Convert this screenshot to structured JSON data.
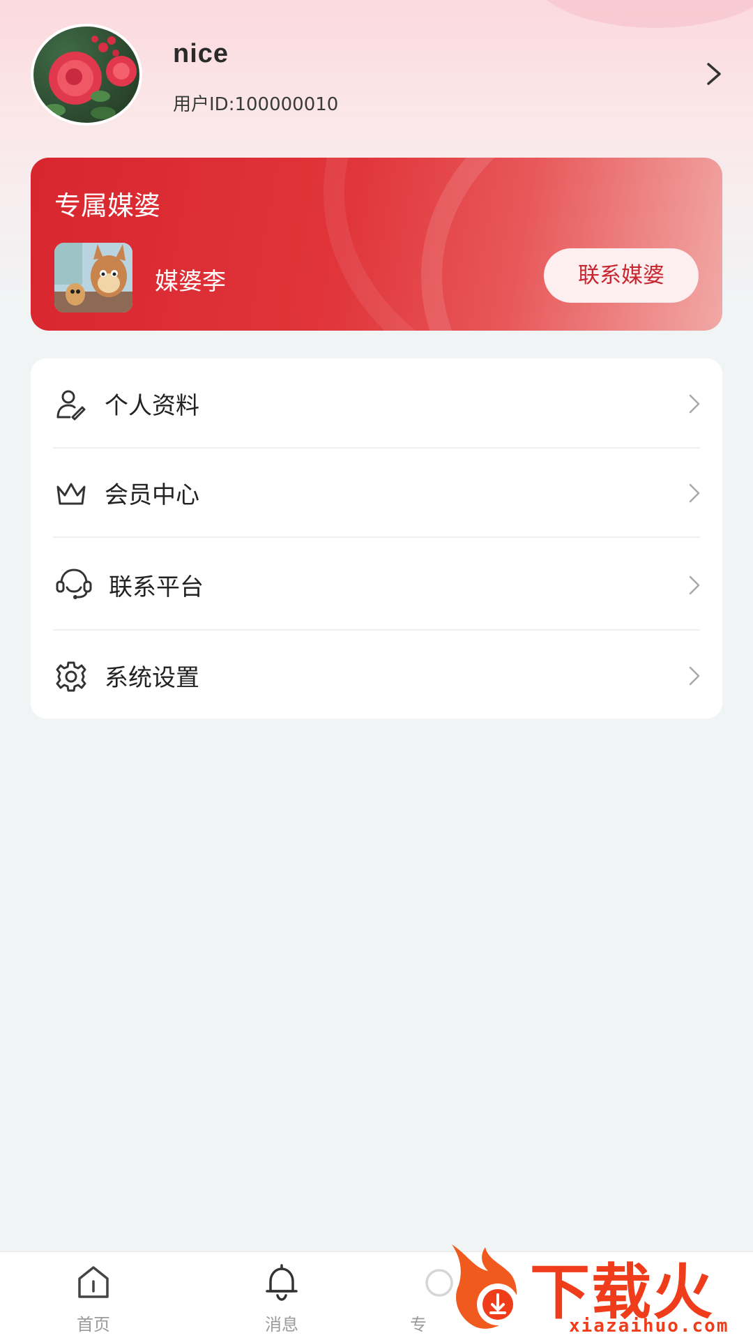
{
  "profile": {
    "name": "nice",
    "user_id": "用户ID:100000010"
  },
  "matchmaker_card": {
    "title": "专属媒婆",
    "name": "媒婆李",
    "contact_button": "联系媒婆"
  },
  "menu": {
    "items": [
      {
        "label": "个人资料",
        "icon": "user-edit-icon"
      },
      {
        "label": "会员中心",
        "icon": "crown-icon"
      },
      {
        "label": "联系平台",
        "icon": "headset-icon"
      },
      {
        "label": "系统设置",
        "icon": "gear-icon"
      }
    ]
  },
  "tabbar": {
    "tabs": [
      {
        "label": "首页",
        "icon": "home-icon"
      },
      {
        "label": "消息",
        "icon": "bell-icon"
      },
      {
        "label": "专",
        "icon": "tab-icon-partial"
      }
    ]
  },
  "watermark": {
    "text": "下载火",
    "url": "xiazaihuo.com"
  },
  "colors": {
    "accent_red": "#d8262e",
    "page_bg": "#f1f4f5",
    "button_bg": "#fdeef0",
    "watermark": "#ef3d1c"
  }
}
